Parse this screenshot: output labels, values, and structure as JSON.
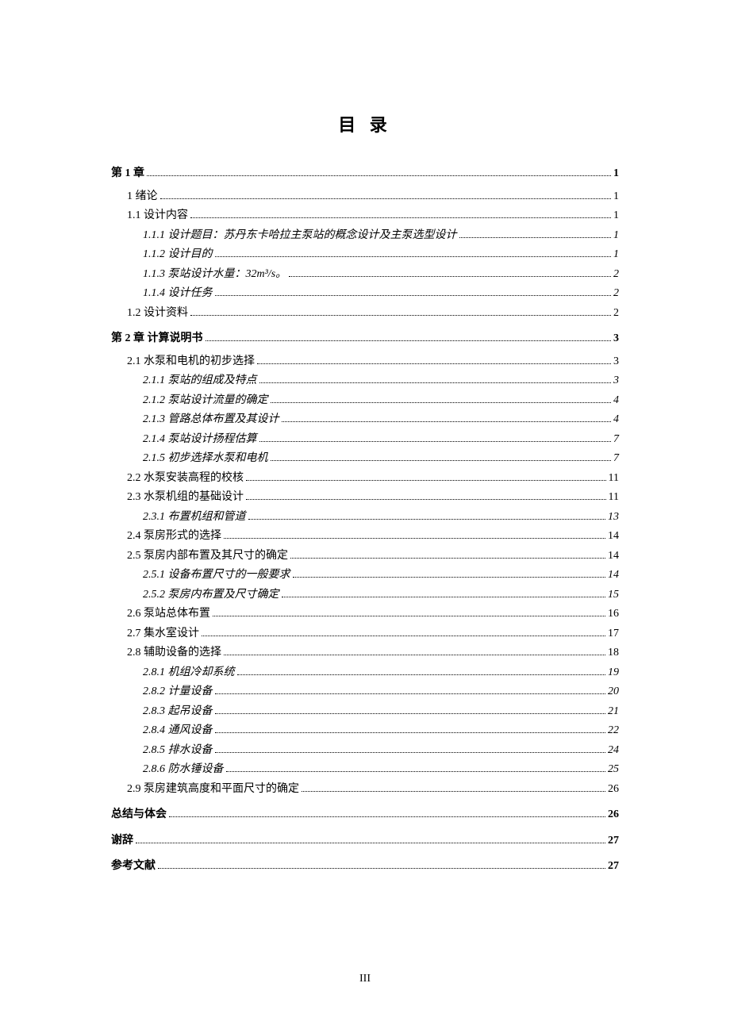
{
  "title": "目 录",
  "pageNumber": "III",
  "toc": [
    {
      "level": 1,
      "text": "第 1 章",
      "page": "1"
    },
    {
      "level": 2,
      "text": "1 绪论",
      "page": "1"
    },
    {
      "level": 2,
      "text": "1.1 设计内容",
      "page": "1"
    },
    {
      "level": 3,
      "text": "1.1.1 设计题目：苏丹东卡哈拉主泵站的概念设计及主泵选型设计",
      "page": "1"
    },
    {
      "level": 3,
      "text": "1.1.2 设计目的",
      "page": "1"
    },
    {
      "level": 3,
      "text": "1.1.3 泵站设计水量：32m³/s。",
      "page": "2"
    },
    {
      "level": 3,
      "text": "1.1.4 设计任务",
      "page": "2"
    },
    {
      "level": 2,
      "text": "1.2 设计资料",
      "page": "2"
    },
    {
      "level": 1,
      "text": "第 2 章 计算说明书",
      "page": "3"
    },
    {
      "level": 2,
      "text": "2.1 水泵和电机的初步选择",
      "page": "3"
    },
    {
      "level": 3,
      "text": "2.1.1 泵站的组成及特点",
      "page": "3"
    },
    {
      "level": 3,
      "text": "2.1.2 泵站设计流量的确定",
      "page": "4"
    },
    {
      "level": 3,
      "text": "2.1.3 管路总体布置及其设计",
      "page": "4"
    },
    {
      "level": 3,
      "text": "2.1.4 泵站设计扬程估算",
      "page": "7"
    },
    {
      "level": 3,
      "text": "2.1.5 初步选择水泵和电机",
      "page": "7"
    },
    {
      "level": 2,
      "text": "2.2 水泵安装高程的校核",
      "page": "11"
    },
    {
      "level": 2,
      "text": "2.3 水泵机组的基础设计",
      "page": "11"
    },
    {
      "level": 3,
      "text": "2.3.1 布置机组和管道",
      "page": "13"
    },
    {
      "level": 2,
      "text": "2.4 泵房形式的选择",
      "page": "14"
    },
    {
      "level": 2,
      "text": "2.5 泵房内部布置及其尺寸的确定",
      "page": "14"
    },
    {
      "level": 3,
      "text": "2.5.1 设备布置尺寸的一般要求",
      "page": "14"
    },
    {
      "level": 3,
      "text": "2.5.2 泵房内布置及尺寸确定",
      "page": "15"
    },
    {
      "level": 2,
      "text": "2.6 泵站总体布置",
      "page": "16"
    },
    {
      "level": 2,
      "text": "2.7 集水室设计",
      "page": "17"
    },
    {
      "level": 2,
      "text": "2.8 辅助设备的选择",
      "page": "18"
    },
    {
      "level": 3,
      "text": "2.8.1 机组冷却系统",
      "page": "19"
    },
    {
      "level": 3,
      "text": "2.8.2 计量设备",
      "page": "20"
    },
    {
      "level": 3,
      "text": "2.8.3 起吊设备",
      "page": "21"
    },
    {
      "level": 3,
      "text": "2.8.4 通风设备",
      "page": "22"
    },
    {
      "level": 3,
      "text": "2.8.5 排水设备",
      "page": "24"
    },
    {
      "level": 3,
      "text": "2.8.6 防水锤设备",
      "page": "25"
    },
    {
      "level": 2,
      "text": "2.9 泵房建筑高度和平面尺寸的确定",
      "page": "26"
    },
    {
      "level": 1,
      "text": "总结与体会",
      "page": "26"
    },
    {
      "level": 1,
      "text": "谢辞",
      "page": "27"
    },
    {
      "level": 1,
      "text": "参考文献",
      "page": "27"
    }
  ]
}
